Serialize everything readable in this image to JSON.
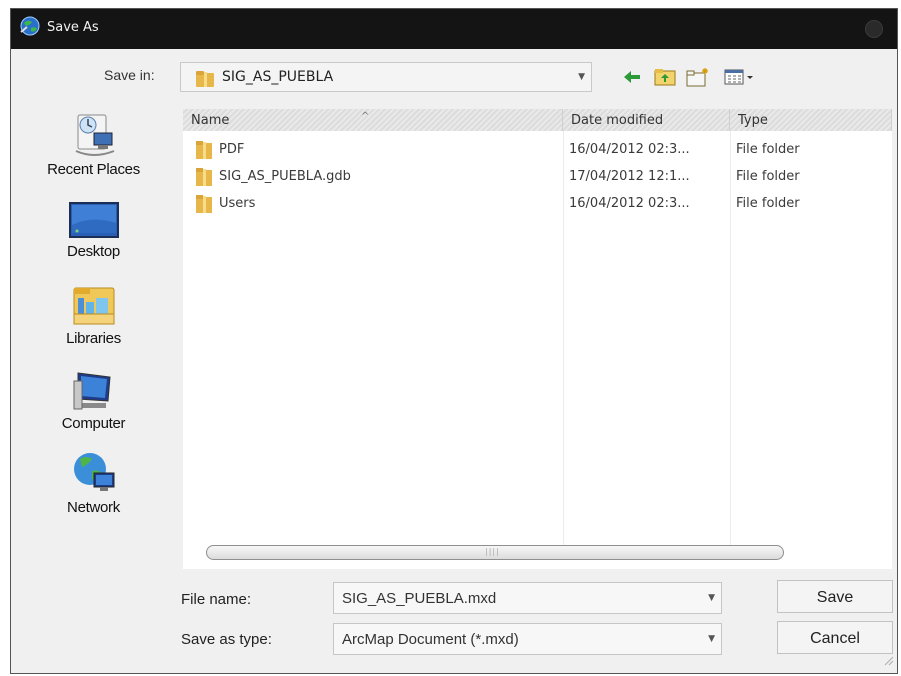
{
  "window": {
    "title": "Save As",
    "icon": "arcmap-globe-icon"
  },
  "toolbar": {
    "save_in_label": "Save in:",
    "current_location": "SIG_AS_PUEBLA",
    "buttons": [
      "back-icon",
      "up-folder-icon",
      "new-folder-icon",
      "view-menu-icon"
    ]
  },
  "places": [
    {
      "label": "Recent Places",
      "icon": "recent-places-icon"
    },
    {
      "label": "Desktop",
      "icon": "desktop-icon"
    },
    {
      "label": "Libraries",
      "icon": "libraries-icon"
    },
    {
      "label": "Computer",
      "icon": "computer-icon"
    },
    {
      "label": "Network",
      "icon": "network-icon"
    }
  ],
  "filelist": {
    "columns": {
      "name": "Name",
      "date": "Date modified",
      "type": "Type"
    },
    "rows": [
      {
        "name": "PDF",
        "date": "16/04/2012 02:3...",
        "type": "File folder"
      },
      {
        "name": "SIG_AS_PUEBLA.gdb",
        "date": "17/04/2012 12:1...",
        "type": "File folder"
      },
      {
        "name": "Users",
        "date": "16/04/2012 02:3...",
        "type": "File folder"
      }
    ]
  },
  "form": {
    "file_name_label": "File name:",
    "file_name_value": "SIG_AS_PUEBLA.mxd",
    "save_type_label": "Save as type:",
    "save_type_value": "ArcMap Document (*.mxd)"
  },
  "buttons": {
    "save": "Save",
    "cancel": "Cancel"
  },
  "colors": {
    "titlebar": "#141414",
    "folder": "#e8b74a",
    "dialog_bg": "#f0f0f0"
  }
}
